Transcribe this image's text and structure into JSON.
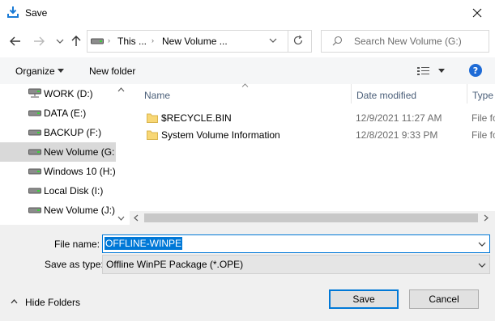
{
  "window": {
    "title": "Save",
    "close_icon": "close-icon",
    "title_icon": "save-arrow-icon"
  },
  "nav": {
    "back_icon": "back-arrow-icon",
    "forward_icon": "forward-arrow-icon",
    "recent_icon": "chevron-down-icon",
    "up_icon": "up-arrow-icon",
    "breadcrumb": [
      "This ...",
      "New Volume ..."
    ],
    "refresh_icon": "refresh-icon",
    "search_placeholder": "Search New Volume (G:)"
  },
  "commandbar": {
    "organize": "Organize",
    "new_folder": "New folder",
    "view_icon": "view-list-icon",
    "help_icon": "help-icon"
  },
  "sidebar": {
    "items": [
      {
        "label": "WORK (D:)",
        "icon": "network-drive-icon",
        "selected": false
      },
      {
        "label": "DATA (E:)",
        "icon": "drive-icon",
        "selected": false
      },
      {
        "label": "BACKUP (F:)",
        "icon": "drive-icon",
        "selected": false
      },
      {
        "label": "New Volume (G:",
        "icon": "drive-icon",
        "selected": true
      },
      {
        "label": "Windows 10 (H:)",
        "icon": "drive-icon",
        "selected": false
      },
      {
        "label": "Local Disk (I:)",
        "icon": "drive-icon",
        "selected": false
      },
      {
        "label": "New Volume (J:)",
        "icon": "drive-icon",
        "selected": false
      }
    ]
  },
  "filelist": {
    "columns": {
      "name": "Name",
      "date": "Date modified",
      "type": "Type"
    },
    "rows": [
      {
        "name": "$RECYCLE.BIN",
        "date": "12/9/2021 11:27 AM",
        "type": "File fo"
      },
      {
        "name": "System Volume Information",
        "date": "12/8/2021 9:33 PM",
        "type": "File fo"
      }
    ]
  },
  "form": {
    "file_name_label": "File name:",
    "file_name_value": "OFFLINE-WINPE",
    "save_type_label": "Save as type:",
    "save_type_value": "Offline WinPE Package (*.OPE)"
  },
  "footer": {
    "hide_folders": "Hide Folders",
    "save": "Save",
    "cancel": "Cancel"
  },
  "colors": {
    "accent": "#0078d7",
    "selection": "#d9d9d9",
    "folder": "#f8d775",
    "help": "#1e6bd6"
  }
}
